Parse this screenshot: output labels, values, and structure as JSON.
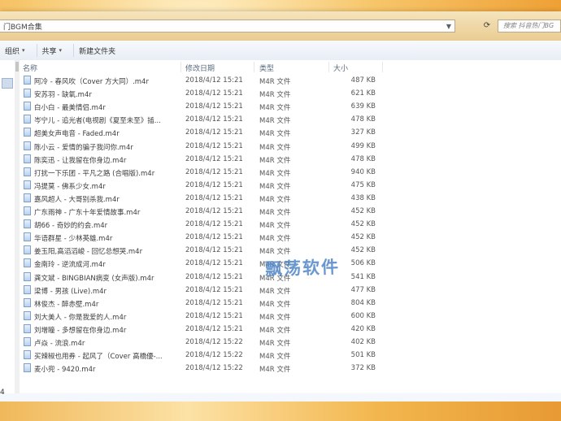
{
  "window": {
    "breadcrumb": "门BGM合集",
    "search_placeholder": "搜索 抖音热门BG"
  },
  "toolbar": {
    "items": [
      "组织",
      "共享",
      "新建文件夹"
    ]
  },
  "columns": {
    "name": "名称",
    "date": "修改日期",
    "type": "类型",
    "size": "大小"
  },
  "files": [
    {
      "name": "阿冷 - 春风吹（Cover 方大同）.m4r",
      "date": "2018/4/12 15:21",
      "type": "M4R 文件",
      "size": "487 KB"
    },
    {
      "name": "安苏羽 - 缺氧.m4r",
      "date": "2018/4/12 15:21",
      "type": "M4R 文件",
      "size": "621 KB"
    },
    {
      "name": "白小白 - 最美情侣.m4r",
      "date": "2018/4/12 15:21",
      "type": "M4R 文件",
      "size": "639 KB"
    },
    {
      "name": "岑宁儿 - 追光者(电视剧《夏至未至》插...",
      "date": "2018/4/12 15:21",
      "type": "M4R 文件",
      "size": "478 KB"
    },
    {
      "name": "超美女声电音 - Faded.m4r",
      "date": "2018/4/12 15:21",
      "type": "M4R 文件",
      "size": "327 KB"
    },
    {
      "name": "陈小云 - 爱情的骗子我问你.m4r",
      "date": "2018/4/12 15:21",
      "type": "M4R 文件",
      "size": "499 KB"
    },
    {
      "name": "陈奕迅 - 让我留在你身边.m4r",
      "date": "2018/4/12 15:21",
      "type": "M4R 文件",
      "size": "478 KB"
    },
    {
      "name": "打扰一下乐团 - 平凡之路 (合唱版).m4r",
      "date": "2018/4/12 15:21",
      "type": "M4R 文件",
      "size": "940 KB"
    },
    {
      "name": "冯提莫 - 佛系少女.m4r",
      "date": "2018/4/12 15:21",
      "type": "M4R 文件",
      "size": "475 KB"
    },
    {
      "name": "嘉风超人 - 大哥别杀我.m4r",
      "date": "2018/4/12 15:21",
      "type": "M4R 文件",
      "size": "438 KB"
    },
    {
      "name": "广东雨神 - 广东十年爱情故事.m4r",
      "date": "2018/4/12 15:21",
      "type": "M4R 文件",
      "size": "452 KB"
    },
    {
      "name": "胡66 - 奇妙的约会.m4r",
      "date": "2018/4/12 15:21",
      "type": "M4R 文件",
      "size": "452 KB"
    },
    {
      "name": "华语群星 - 少林英雄.m4r",
      "date": "2018/4/12 15:21",
      "type": "M4R 文件",
      "size": "452 KB"
    },
    {
      "name": "姜玉阳,高滔滔峻 - 回忆总想哭.m4r",
      "date": "2018/4/12 15:21",
      "type": "M4R 文件",
      "size": "452 KB"
    },
    {
      "name": "金南玲 - 逆流成河.m4r",
      "date": "2018/4/12 15:21",
      "type": "M4R 文件",
      "size": "506 KB"
    },
    {
      "name": "龚文斌 - BINGBIAN病变 (女声版).m4r",
      "date": "2018/4/12 15:21",
      "type": "M4R 文件",
      "size": "541 KB"
    },
    {
      "name": "梁博 - 男孩 (Live).m4r",
      "date": "2018/4/12 15:21",
      "type": "M4R 文件",
      "size": "477 KB"
    },
    {
      "name": "林俊杰 - 醉赤壁.m4r",
      "date": "2018/4/12 15:21",
      "type": "M4R 文件",
      "size": "804 KB"
    },
    {
      "name": "刘大美人 - 你是我爱的人.m4r",
      "date": "2018/4/12 15:21",
      "type": "M4R 文件",
      "size": "600 KB"
    },
    {
      "name": "刘增瞳 - 多想留在你身边.m4r",
      "date": "2018/4/12 15:21",
      "type": "M4R 文件",
      "size": "420 KB"
    },
    {
      "name": "卢焱 - 流浪.m4r",
      "date": "2018/4/12 15:22",
      "type": "M4R 文件",
      "size": "402 KB"
    },
    {
      "name": "买辣椒也用券 - 起风了（Cover 高橋優-...",
      "date": "2018/4/12 15:22",
      "type": "M4R 文件",
      "size": "501 KB"
    },
    {
      "name": "麦小兜 - 9420.m4r",
      "date": "2018/4/12 15:22",
      "type": "M4R 文件",
      "size": "372 KB"
    }
  ],
  "watermark": "飘荡软件",
  "status": {
    "partial_text": "4"
  }
}
